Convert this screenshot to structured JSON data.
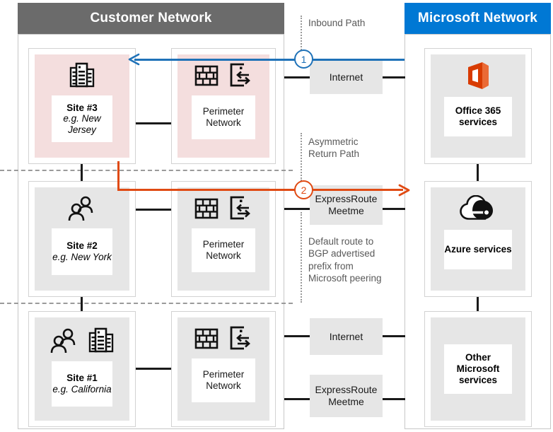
{
  "zones": {
    "customer": {
      "title": "Customer Network",
      "color": "#6b6b6b"
    },
    "microsoft": {
      "title": "Microsoft Network",
      "color": "#0078d4"
    }
  },
  "sites": [
    {
      "id": "site3",
      "name": "Site #3",
      "location": "e.g. New Jersey",
      "icons": [
        "building-icon"
      ],
      "highlight": "#f4dede",
      "perimeter": {
        "label": "Perimeter Network",
        "icons": [
          "firewall-icon",
          "router-icon"
        ],
        "highlight": "#f4dede"
      }
    },
    {
      "id": "site2",
      "name": "Site #2",
      "location": "e.g. New York",
      "icons": [
        "people-icon"
      ],
      "highlight": "#e6e6e6",
      "perimeter": {
        "label": "Perimeter Network",
        "icons": [
          "firewall-icon",
          "router-icon"
        ],
        "highlight": "#e6e6e6"
      }
    },
    {
      "id": "site1",
      "name": "Site #1",
      "location": "e.g. California",
      "icons": [
        "people-icon",
        "building-icon"
      ],
      "highlight": "#e6e6e6",
      "perimeter": {
        "label": "Perimeter Network",
        "icons": [
          "firewall-icon",
          "router-icon"
        ],
        "highlight": "#e6e6e6"
      }
    }
  ],
  "transits": [
    {
      "id": "transit-internet-top",
      "label": "Internet"
    },
    {
      "id": "transit-expressroute-mid",
      "label": "ExpressRoute Meetme"
    },
    {
      "id": "transit-internet-bottom",
      "label": "Internet"
    },
    {
      "id": "transit-expressroute-bottom",
      "label": "ExpressRoute Meetme"
    }
  ],
  "services": [
    {
      "id": "office365",
      "label": "Office 365 services",
      "icon": "office-365-icon"
    },
    {
      "id": "azure",
      "label": "Azure services",
      "icon": "azure-cloud-icon"
    },
    {
      "id": "other-microsoft",
      "label": "Other Microsoft services",
      "icon": "none"
    }
  ],
  "annotations": {
    "inbound": "Inbound Path",
    "asymmetric": "Asymmetric Return Path",
    "default_route": "Default route to BGP advertised prefix from Microsoft peering"
  },
  "markers": [
    {
      "id": "marker-1",
      "number": "1",
      "color": "#1f72b8"
    },
    {
      "id": "marker-2",
      "number": "2",
      "color": "#e04a13"
    }
  ],
  "colors": {
    "customer_header": "#6b6b6b",
    "microsoft_header": "#0078d4",
    "inbound_path": "#1f72b8",
    "return_path": "#e04a13",
    "highlight_pink": "#f4dede",
    "node_grey": "#e6e6e6"
  }
}
